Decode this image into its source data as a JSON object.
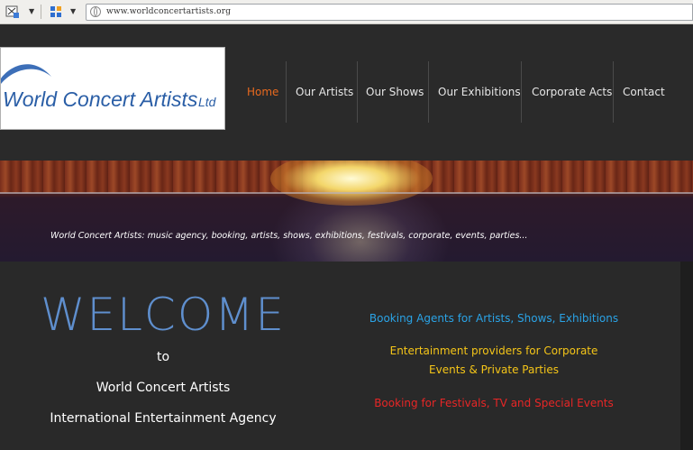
{
  "browser": {
    "url": "www.worldconcertartists.org",
    "icons": [
      "screenshot-icon",
      "dropdown-arrow-icon",
      "apps-grid-icon",
      "dropdown-arrow-icon",
      "globe-icon"
    ]
  },
  "logo": {
    "main_text": "World Concert Artists",
    "suffix": "Ltd"
  },
  "nav": {
    "items": [
      {
        "label": "Home",
        "active": true
      },
      {
        "label": "Our Artists",
        "active": false
      },
      {
        "label": "Our Shows",
        "active": false
      },
      {
        "label": "Our Exhibitions",
        "active": false
      },
      {
        "label": "Corporate Acts",
        "active": false
      },
      {
        "label": "Contact",
        "active": false
      }
    ]
  },
  "banner": {
    "tagline": "World Concert Artists: music agency, booking, artists, shows, exhibitions, festivals, corporate, events, parties..."
  },
  "welcome": {
    "title": "WELCOME",
    "to": "to",
    "name": "World Concert Artists",
    "agency": "International Entertainment Agency"
  },
  "services": {
    "line1": "Booking Agents for Artists, Shows, Exhibitions",
    "line2a": "Entertainment providers for Corporate",
    "line2b": "Events & Private Parties",
    "line3": "Booking for Festivals, TV and Special Events"
  },
  "colors": {
    "nav_active": "#e8691e",
    "welcome_title": "#5f8fce",
    "service_blue": "#2aa3e6",
    "service_yellow": "#f5c518",
    "service_red": "#e82626",
    "logo_blue": "#2a5ea6"
  }
}
